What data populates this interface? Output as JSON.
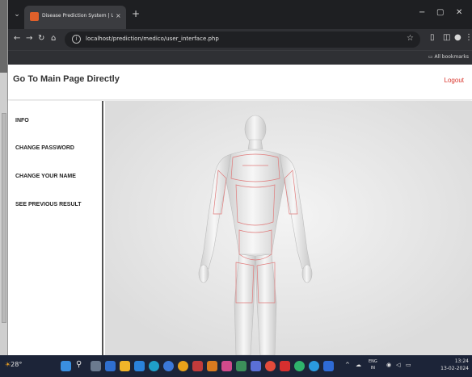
{
  "browser": {
    "tab_title": "Disease Prediction System | Use",
    "tab_close": "×",
    "new_tab": "+",
    "url": "localhost/prediction/medico/user_interface.php",
    "bookmarks_label": "All bookmarks",
    "window_controls": [
      "−",
      "▢",
      "✕"
    ]
  },
  "page": {
    "brand": "Go To Main Page Directly",
    "logout": "Logout",
    "sidebar": [
      {
        "label": "INFO"
      },
      {
        "label": "CHANGE PASSWORD"
      },
      {
        "label": "CHANGE YOUR NAME"
      },
      {
        "label": "SEE PREVIOUS RESULT"
      }
    ]
  },
  "taskbar": {
    "weather": "28°",
    "lang": "ENG",
    "region": "IN",
    "time": "13:24",
    "date": "13-02-2024"
  },
  "colors": {
    "accent_logout": "#d9342b",
    "body_outline": "#e07a7a"
  },
  "icons": {
    "back": "arrow-left-icon",
    "forward": "arrow-right-icon",
    "reload": "reload-icon",
    "home": "home-icon",
    "star": "star-icon"
  }
}
